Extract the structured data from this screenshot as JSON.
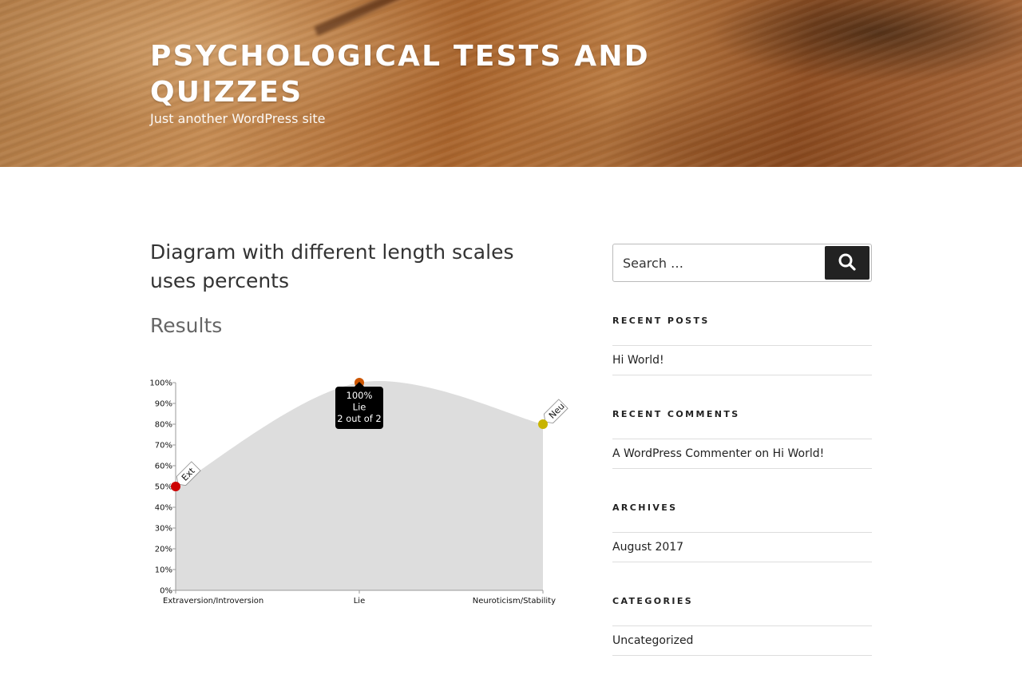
{
  "site": {
    "title": "PSYCHOLOGICAL TESTS AND QUIZZES",
    "description": "Just another WordPress site"
  },
  "post": {
    "title": "Diagram with different length scales uses percents",
    "results_heading": "Results"
  },
  "chart_data": {
    "type": "area",
    "categories": [
      "Extraversion/Introversion",
      "Lie",
      "Neuroticism/Stability"
    ],
    "values": [
      50,
      100,
      80
    ],
    "point_tags": [
      "Ext",
      "",
      "Neu"
    ],
    "point_colors": [
      "#cc0000",
      "#cc5500",
      "#c8b400"
    ],
    "ylim": [
      0,
      100
    ],
    "yticks": [
      0,
      10,
      20,
      30,
      40,
      50,
      60,
      70,
      80,
      90,
      100
    ],
    "ytick_labels": [
      "0%",
      "10%",
      "20%",
      "30%",
      "40%",
      "50%",
      "60%",
      "70%",
      "80%",
      "90%",
      "100%"
    ],
    "fill_color": "#dddddd",
    "tooltip": {
      "category_index": 1,
      "lines": [
        "100%",
        "Lie",
        "2 out of 2"
      ]
    }
  },
  "sidebar": {
    "search": {
      "placeholder": "Search …",
      "button_icon": "search-icon"
    },
    "recent_posts": {
      "title": "RECENT POSTS",
      "items": [
        "Hi World!"
      ]
    },
    "recent_comments": {
      "title": "RECENT COMMENTS",
      "author": "A WordPress Commenter",
      "connector": "on",
      "post": "Hi World!"
    },
    "archives": {
      "title": "ARCHIVES",
      "items": [
        "August 2017"
      ]
    },
    "categories": {
      "title": "CATEGORIES",
      "items": [
        "Uncategorized"
      ]
    }
  }
}
